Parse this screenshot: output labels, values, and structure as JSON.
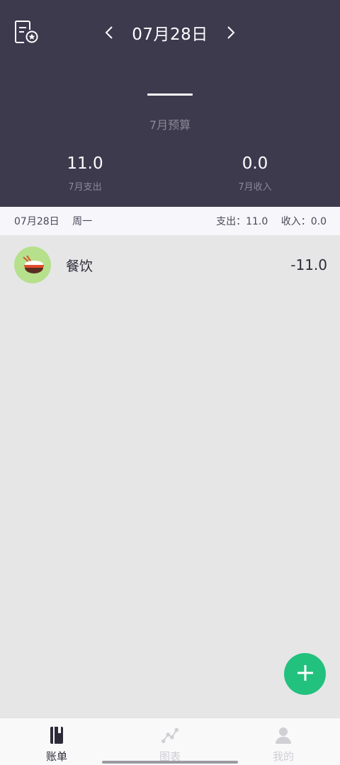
{
  "header": {
    "date": "07月28日",
    "budget_label": "7月预算",
    "expense_value": "11.0",
    "expense_label": "7月支出",
    "income_value": "0.0",
    "income_label": "7月收入",
    "prev_icon": "chevron-left-icon",
    "next_icon": "chevron-right-icon",
    "bill_icon": "bill-settings-icon"
  },
  "day": {
    "date": "07月28日",
    "weekday": "周一",
    "expense": "支出：11.0",
    "income": "收入：0.0"
  },
  "entries": [
    {
      "category": "餐饮",
      "amount": "-11.0",
      "icon": "food-bowl-icon",
      "icon_bg": "#b6e08c"
    }
  ],
  "fab": {
    "icon": "plus-icon",
    "color": "#22c17e"
  },
  "tabs": [
    {
      "label": "账单",
      "icon": "book-icon",
      "active": true
    },
    {
      "label": "图表",
      "icon": "chart-icon",
      "active": false
    },
    {
      "label": "我的",
      "icon": "person-icon",
      "active": false
    }
  ],
  "colors": {
    "header_bg": "#3d3a4e",
    "body_bg": "#e6e6e7",
    "accent": "#22c17e"
  }
}
